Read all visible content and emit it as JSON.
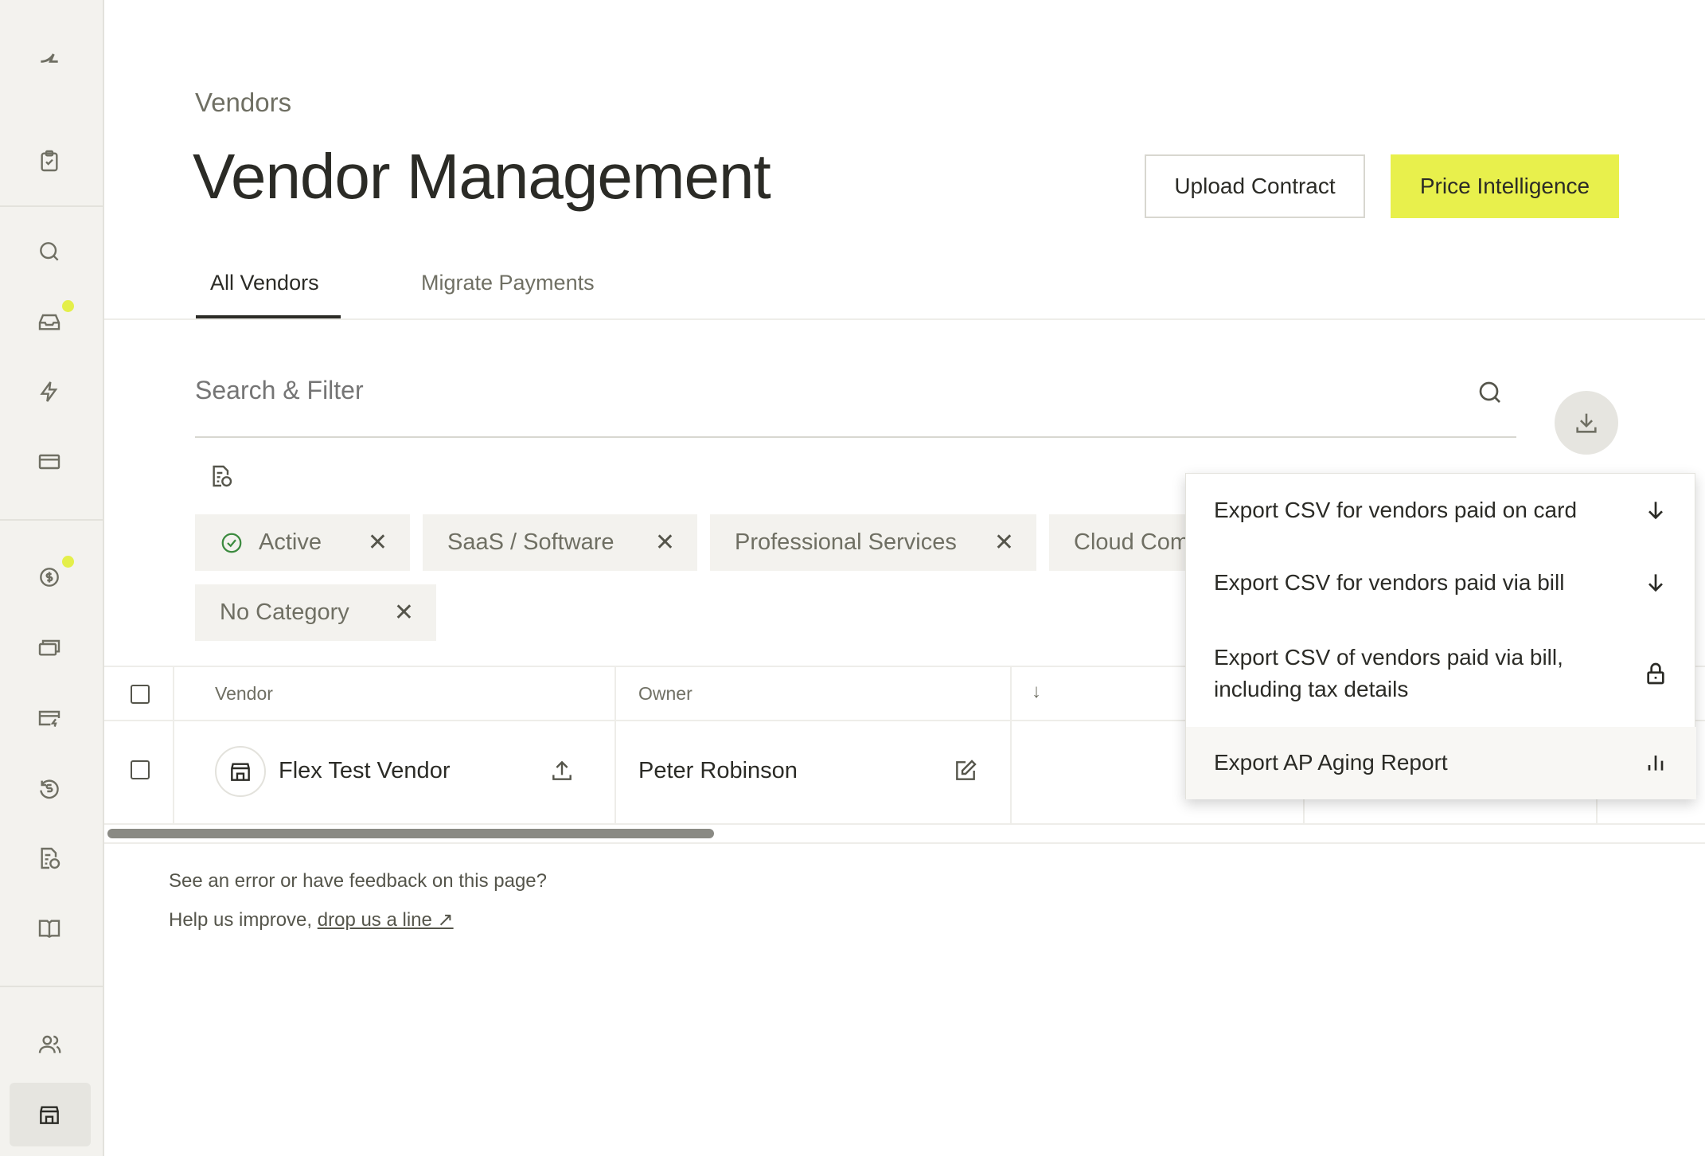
{
  "sidebar": {
    "items": [
      "logo-icon",
      "clipboard-check-icon",
      "search-icon",
      "inbox-icon",
      "lightning-icon",
      "card-icon",
      "dollar-circle-icon",
      "cards-stack-icon",
      "card-lightning-icon",
      "refund-dollar-icon",
      "invoice-dollar-icon",
      "book-icon",
      "users-icon",
      "store-icon"
    ],
    "accent": "#e4ef4a"
  },
  "header": {
    "breadcrumb": "Vendors",
    "title": "Vendor Management",
    "upload_label": "Upload Contract",
    "price_label": "Price Intelligence",
    "accent": "#e8f04c"
  },
  "tabs": [
    {
      "label": "All Vendors",
      "active": true
    },
    {
      "label": "Migrate Payments",
      "active": false
    }
  ],
  "search": {
    "placeholder": "Search & Filter"
  },
  "chips": [
    "Active",
    "SaaS / Software",
    "Professional Services",
    "Cloud Com",
    "No Category"
  ],
  "table": {
    "headers": [
      "Vendor",
      "Owner"
    ],
    "rows": [
      {
        "vendor": "Flex Test Vendor",
        "owner": "Peter Robinson"
      }
    ]
  },
  "export_menu": {
    "items": [
      "Export CSV for vendors paid on card",
      "Export CSV for vendors paid via bill",
      "Export CSV of vendors paid via bill, including tax details",
      "Export AP Aging Report"
    ]
  },
  "footer": {
    "line1": "See an error or have feedback on this page?",
    "line2": "Help us improve, ",
    "link": "drop us a line ↗"
  }
}
